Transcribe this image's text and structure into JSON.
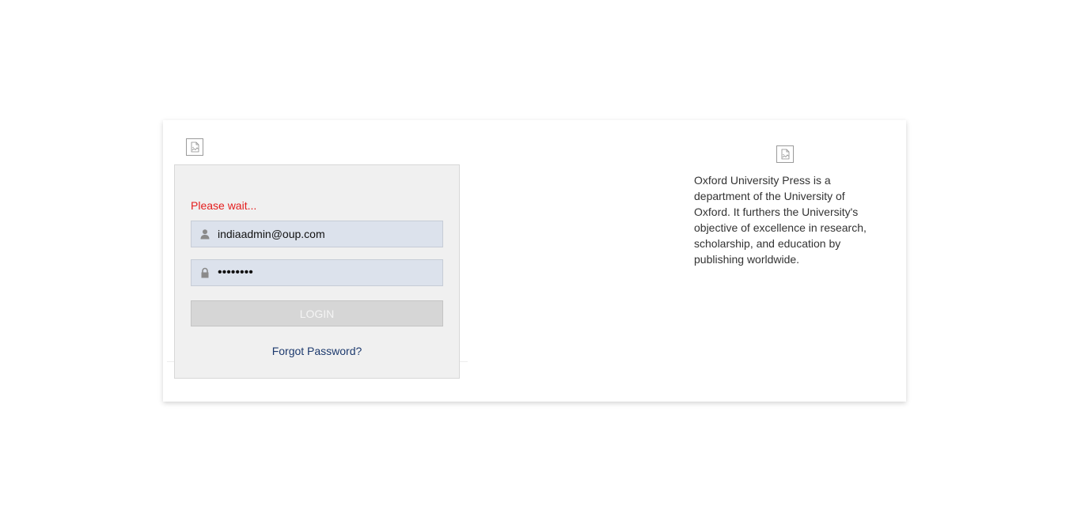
{
  "login": {
    "status_message": "Please wait...",
    "email_value": "indiaadmin@oup.com",
    "password_value": "••••••••",
    "login_button_label": "LOGIN",
    "forgot_password_label": "Forgot Password?"
  },
  "about": {
    "description": "Oxford University Press is a department of the University of Oxford. It furthers the University's objective of excellence in research, scholarship, and education by publishing worldwide."
  },
  "icons": {
    "email": "user-icon",
    "password": "lock-icon",
    "logo_left": "broken-image-icon",
    "logo_right": "broken-image-icon"
  },
  "colors": {
    "status": "#e41d1d",
    "link": "#1d3a6e",
    "panel_bg": "#f0f0f0",
    "field_bg": "#dce2ec",
    "button_bg": "#d6d6d6"
  }
}
